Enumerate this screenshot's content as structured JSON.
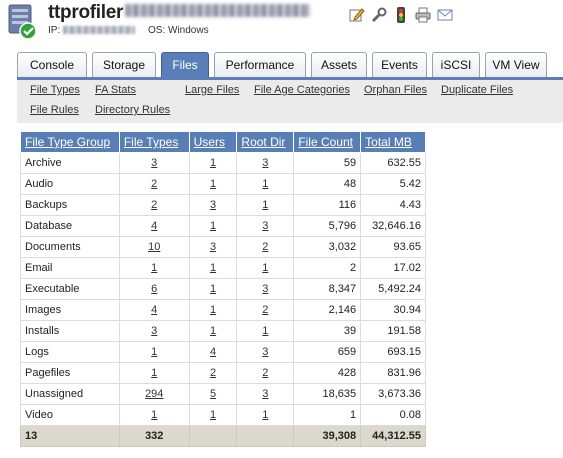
{
  "header": {
    "app_name": "ttprofiler",
    "ip_label": "IP:",
    "os_label": "OS: Windows"
  },
  "toolbar_icons": [
    "edit-icon",
    "wrench-icon",
    "traffic-light-icon",
    "printer-icon",
    "email-icon"
  ],
  "tabs": [
    {
      "label": "Console",
      "active": false
    },
    {
      "label": "Storage",
      "active": false
    },
    {
      "label": "Files",
      "active": true
    },
    {
      "label": "Performance",
      "active": false
    },
    {
      "label": "Assets",
      "active": false
    },
    {
      "label": "Events",
      "active": false
    },
    {
      "label": "iSCSI",
      "active": false
    },
    {
      "label": "VM View",
      "active": false
    }
  ],
  "subnav": {
    "file_types": "File Types",
    "fa_stats": "FA Stats",
    "large_files": "Large Files",
    "file_age_categories": "File Age Categories",
    "orphan_files": "Orphan Files",
    "duplicate_files": "Duplicate Files",
    "file_rules": "File Rules",
    "directory_rules": "Directory Rules"
  },
  "table": {
    "columns": [
      "File Type Group",
      "File Types",
      "Users",
      "Root Dir",
      "File Count",
      "Total MB"
    ],
    "rows": [
      [
        "Archive",
        "3",
        "1",
        "3",
        "59",
        "632.55"
      ],
      [
        "Audio",
        "2",
        "1",
        "1",
        "48",
        "5.42"
      ],
      [
        "Backups",
        "2",
        "3",
        "1",
        "116",
        "4.43"
      ],
      [
        "Database",
        "4",
        "1",
        "3",
        "5,796",
        "32,646.16"
      ],
      [
        "Documents",
        "10",
        "3",
        "2",
        "3,032",
        "93.65"
      ],
      [
        "Email",
        "1",
        "1",
        "1",
        "2",
        "17.02"
      ],
      [
        "Executable",
        "6",
        "1",
        "3",
        "8,347",
        "5,492.24"
      ],
      [
        "Images",
        "4",
        "1",
        "2",
        "2,146",
        "30.94"
      ],
      [
        "Installs",
        "3",
        "1",
        "1",
        "39",
        "191.58"
      ],
      [
        "Logs",
        "1",
        "4",
        "3",
        "659",
        "693.15"
      ],
      [
        "Pagefiles",
        "1",
        "2",
        "2",
        "428",
        "831.96"
      ],
      [
        "Unassigned",
        "294",
        "5",
        "3",
        "18,635",
        "3,673.36"
      ],
      [
        "Video",
        "1",
        "1",
        "1",
        "1",
        "0.08"
      ]
    ],
    "totals": {
      "group": "13",
      "file_types": "332",
      "users": "",
      "root_dir": "",
      "file_count": "39,308",
      "total_mb": "44,312.55"
    }
  }
}
